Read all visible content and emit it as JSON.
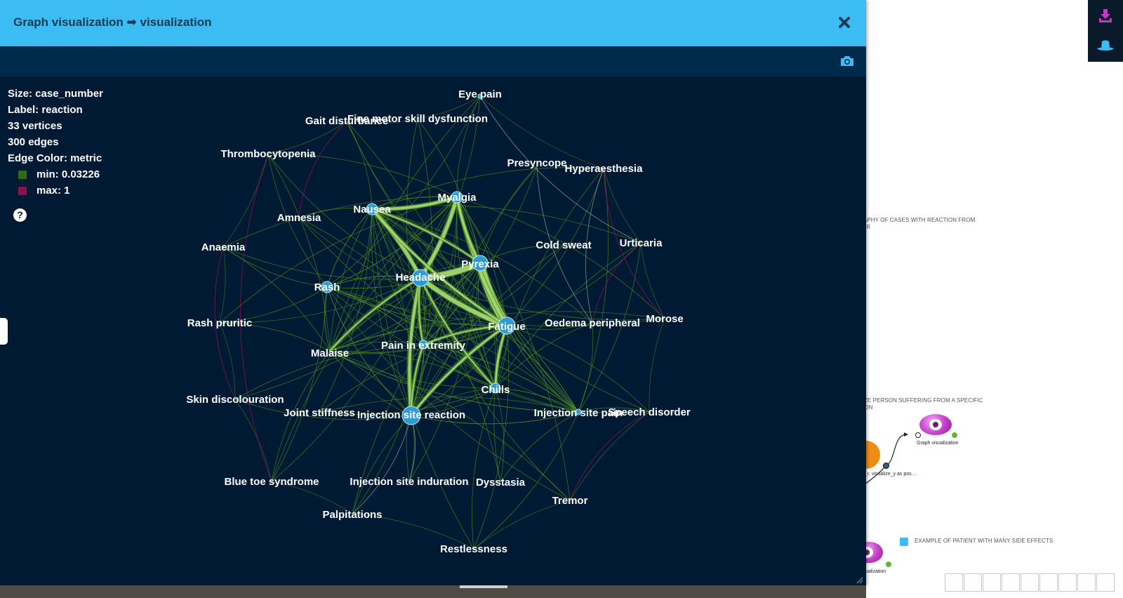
{
  "modal": {
    "title": "Graph visualization ➡ visualization",
    "close_icon": "close-icon",
    "camera_icon": "camera-icon"
  },
  "legend": {
    "size": "Size: case_number",
    "label": "Label: reaction",
    "vertices": "33 vertices",
    "edges": "300 edges",
    "edge_color": "Edge Color: metric",
    "min_label": "min: 0.03226",
    "max_label": "max: 1",
    "min_color": "#2e6b12",
    "max_color": "#8a1050",
    "help": "?"
  },
  "graph": {
    "edge_base_color": "#4e8a22",
    "edge_strong_color": "#aee07a",
    "node_color": "#2e9ad6",
    "vertices": [
      {
        "label": "Eye pain",
        "node": true
      },
      {
        "label": "Fine motor skill dysfunction",
        "node": false
      },
      {
        "label": "Gait disturbance",
        "node": false
      },
      {
        "label": "Thrombocytopenia",
        "node": false
      },
      {
        "label": "Presyncope",
        "node": false
      },
      {
        "label": "Hyperaesthesia",
        "node": false
      },
      {
        "label": "Myalgia",
        "node": true
      },
      {
        "label": "Nausea",
        "node": true
      },
      {
        "label": "Amnesia",
        "node": false
      },
      {
        "label": "Anaemia",
        "node": false
      },
      {
        "label": "Cold sweat",
        "node": false
      },
      {
        "label": "Urticaria",
        "node": false
      },
      {
        "label": "Pyrexia",
        "node": true
      },
      {
        "label": "Headache",
        "node": true
      },
      {
        "label": "Rash",
        "node": true
      },
      {
        "label": "Rash pruritic",
        "node": false
      },
      {
        "label": "Fatigue",
        "node": true
      },
      {
        "label": "Oedema peripheral",
        "node": false
      },
      {
        "label": "Morose",
        "node": false
      },
      {
        "label": "Pain in extremity",
        "node": true
      },
      {
        "label": "Malaise",
        "node": true
      },
      {
        "label": "Chills",
        "node": true
      },
      {
        "label": "Skin discolouration",
        "node": false
      },
      {
        "label": "Joint stiffness",
        "node": false
      },
      {
        "label": "Injection site reaction",
        "node": true
      },
      {
        "label": "Injection site pain",
        "node": true
      },
      {
        "label": "Speech disorder",
        "node": false
      },
      {
        "label": "Blue toe syndrome",
        "node": false
      },
      {
        "label": "Injection site induration",
        "node": false
      },
      {
        "label": "Dysstasia",
        "node": false
      },
      {
        "label": "Tremor",
        "node": false
      },
      {
        "label": "Palpitations",
        "node": false
      },
      {
        "label": "Restlessness",
        "node": false
      }
    ]
  },
  "background": {
    "note_1_line1": "RAPHY OF CASES WITH REACTION FROM",
    "note_1_line2": "TER",
    "note_2_line1": "LIZE PERSON SUFFERING FROM A SPECIFIC",
    "note_2_line2": "TION",
    "note_3": "EXAMPLE OF PATIENT WITH MANY SIDE EFFECTS",
    "node_caption_1": "Graph visualization",
    "node_caption_2": "ber_r, visualize_y as pos…",
    "node_caption_3": "visualization",
    "node_caption_4": "…",
    "download_icon": "download-icon",
    "hat_icon": "hat-icon",
    "accent_pink": "#cc33cc",
    "accent_blue": "#3bbdf4"
  }
}
